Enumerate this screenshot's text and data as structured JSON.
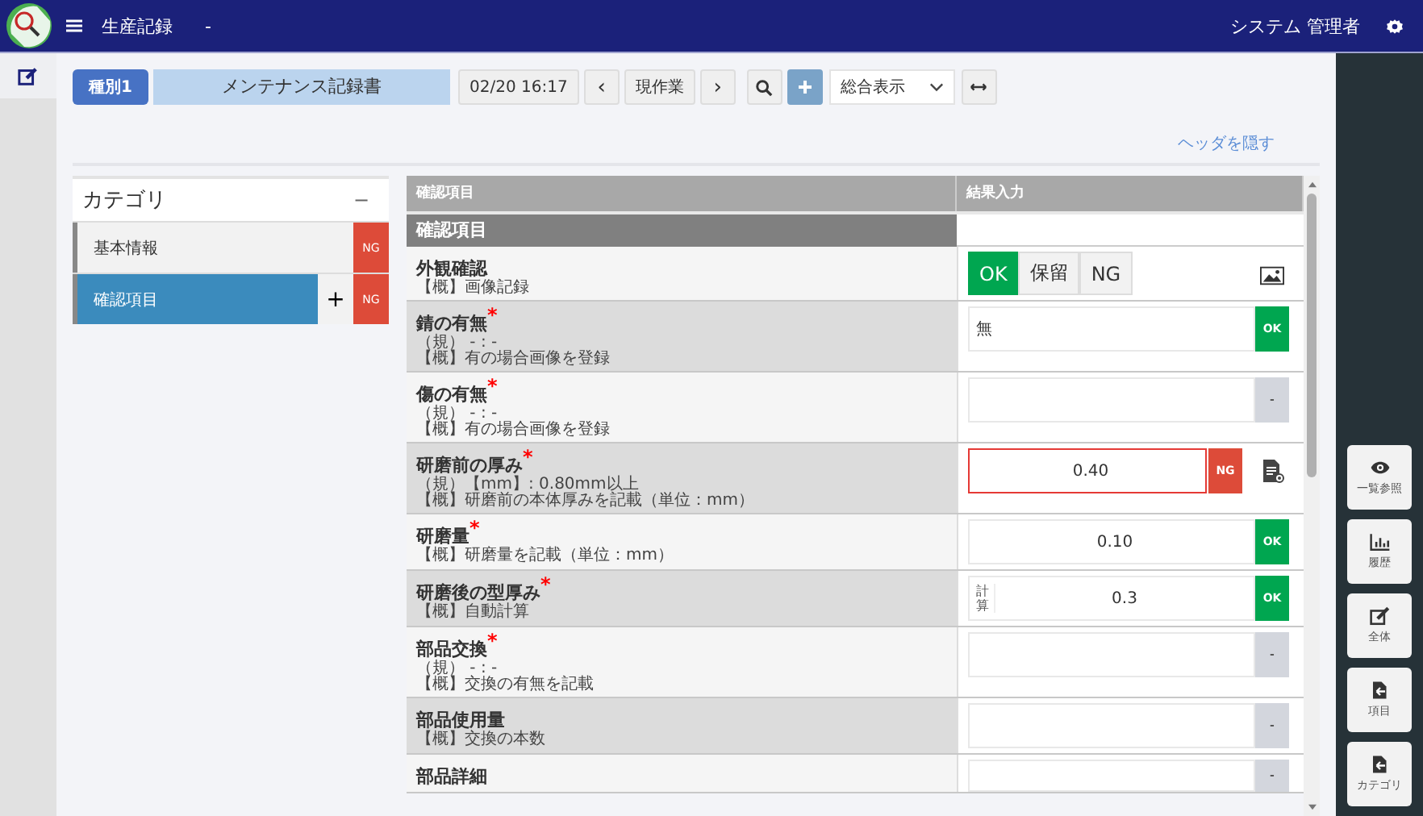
{
  "header": {
    "app_title": "生産記録",
    "subtitle": "-",
    "user": "システム 管理者"
  },
  "toolbar": {
    "type_button": "種別1",
    "document_title": "メンテナンス記録書",
    "datetime": "02/20 16:17",
    "prev": "‹",
    "current": "現作業",
    "next": "›",
    "view_select": "総合表示"
  },
  "hide_header_link": "ヘッダを隠す",
  "category": {
    "title": "カテゴリ",
    "collapse": "−",
    "items": [
      {
        "label": "基本情報",
        "selected": false,
        "badge": "NG"
      },
      {
        "label": "確認項目",
        "selected": true,
        "badge": "NG",
        "add": "+"
      }
    ]
  },
  "table": {
    "columns": [
      "確認項目",
      "結果入力"
    ],
    "section": "確認項目",
    "rows": [
      {
        "name": "外観確認",
        "notes": [
          "【概】画像記録"
        ],
        "kind": "choice",
        "options": [
          {
            "label": "OK",
            "selected": true
          },
          {
            "label": "保留",
            "selected": false
          },
          {
            "label": "NG",
            "selected": false
          }
        ]
      },
      {
        "name": "錆の有無$^{*}$",
        "notes": [
          "（規） - : -",
          "【概】有の場合画像を登録"
        ],
        "kind": "text",
        "value": "無",
        "error": false,
        "badge": {
          "label": "OK",
          "color": "#00a650"
        }
      },
      {
        "name": "傷の有無$^{*}$",
        "notes": [
          "（規） - : -",
          "【概】有の場合画像を登録"
        ],
        "kind": "text",
        "value": "",
        "error": false,
        "badge": {
          "label": "-",
          "color": "#d3d6dd"
        }
      },
      {
        "name": "研磨前の厚み$^{*}$",
        "notes": [
          "（規）【mm】: 0.80mm以上",
          "【概】研磨前の本体厚みを記載（単位：mm）"
        ],
        "kind": "number",
        "value": "0.40",
        "error": true,
        "badge": {
          "label": "NG",
          "color": "#dd4b39"
        }
      },
      {
        "name": "研磨量$^{*}$",
        "notes": [
          "【概】研磨量を記載（単位：mm）"
        ],
        "kind": "number",
        "value": "0.10",
        "error": false,
        "badge": {
          "label": "OK",
          "color": "#00a650"
        }
      },
      {
        "name": "研磨後の型厚み$^{*}$",
        "notes": [
          "【概】自動計算"
        ],
        "kind": "number",
        "prefix": "計算",
        "value": "0.3",
        "error": false,
        "badge": {
          "label": "OK",
          "color": "#00a650"
        }
      },
      {
        "name": "部品交換$^{*}$",
        "notes": [
          "（規） - : -",
          "【概】交換の有無を記載"
        ],
        "kind": "text",
        "value": "",
        "error": false,
        "badge": {
          "label": "-",
          "color": "#d3d6dd"
        }
      },
      {
        "name": "部品使用量",
        "notes": [
          "【概】交換の本数"
        ],
        "kind": "text",
        "value": "",
        "error": false,
        "badge": {
          "label": "-",
          "color": "#d3d6dd"
        }
      },
      {
        "name": "部品詳細",
        "notes": [],
        "kind": "text",
        "value": "",
        "error": false,
        "badge": {
          "label": "-",
          "color": "#d3d6dd"
        }
      }
    ]
  },
  "side_actions": [
    {
      "label": "一覧参照",
      "kind": "eye"
    },
    {
      "label": "履歴",
      "kind": "chart"
    },
    {
      "label": "全体",
      "kind": "edit"
    },
    {
      "label": "項目",
      "kind": "file"
    },
    {
      "label": "カテゴリ",
      "kind": "file"
    }
  ]
}
